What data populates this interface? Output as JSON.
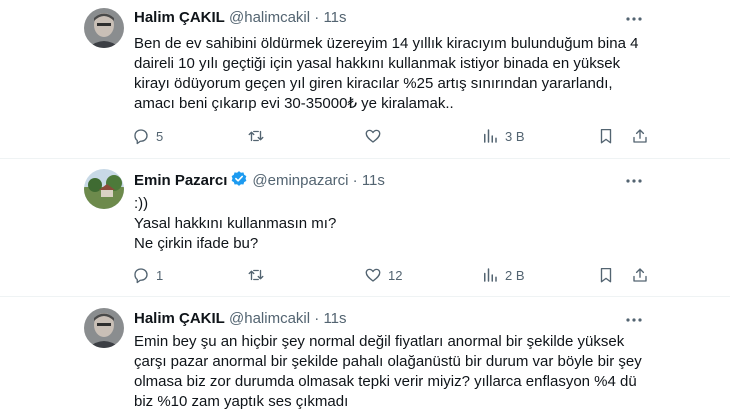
{
  "tweets": [
    {
      "name": "Halim ÇAKIL",
      "handle": "@halimcakil",
      "time": "11s",
      "lines": [
        "Ben de ev sahibini öldürmek üzereyim 14 yıllık kiracıyım bulunduğum bina 4",
        "daireli   10 yılı geçtiği için yasal hakkını kullanmak istiyor binada en yüksek",
        "kirayı ödüyorum geçen yıl giren kiracılar %25 artış sınırından yararlandı,",
        "amacı beni çıkarıp evi 30-35000₺ ye kiralamak.."
      ],
      "replies": "5",
      "retweets": "",
      "likes": "",
      "views": "3 B"
    },
    {
      "name": "Emin Pazarcı",
      "handle": "@eminpazarci",
      "time": "11s",
      "lines": [
        ":))",
        "Yasal hakkını kullanmasın mı?",
        "Ne çirkin ifade bu?"
      ],
      "replies": "1",
      "retweets": "",
      "likes": "12",
      "views": "2 B"
    },
    {
      "name": "Halim ÇAKIL",
      "handle": "@halimcakil",
      "time": "11s",
      "lines": [
        "Emin bey şu an hiçbir şey normal değil fiyatları anormal bir şekilde yüksek",
        "çarşı pazar anormal bir şekilde pahalı olağanüstü bir durum var böyle bir şey",
        "olmasa biz zor durumda olmasak tepki verir miyiz? yıllarca enflasyon %4 dü",
        "biz %10 zam yaptık ses çıkmadı"
      ]
    }
  ],
  "colors": {
    "text": "#0f1419",
    "muted": "#536471",
    "verified": "#1d9bf0",
    "separator": "#eff3f4"
  }
}
